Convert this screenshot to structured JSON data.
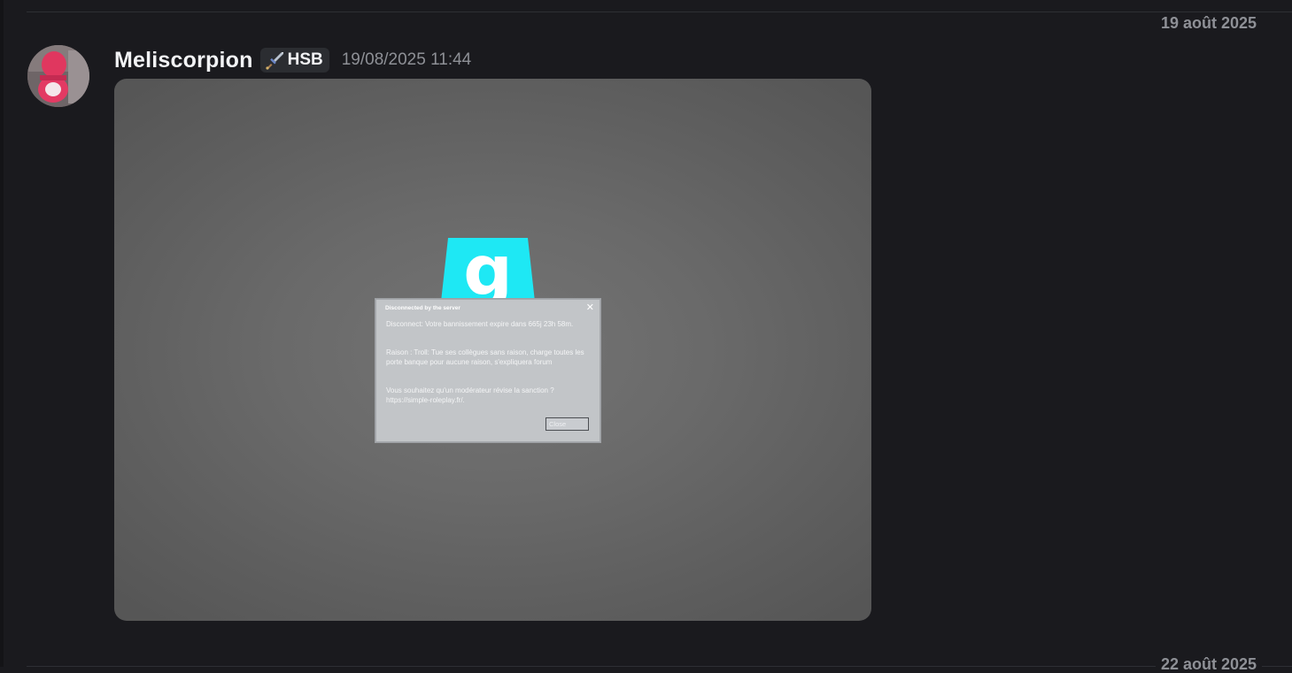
{
  "date_dividers": {
    "top": "19 août 2025",
    "bottom": "22 août 2025"
  },
  "message": {
    "username": "Meliscorpion",
    "tag": {
      "icon": "sword-icon",
      "label": "HSB"
    },
    "timestamp": "19/08/2025 11:44",
    "attachment": {
      "logo_letter": "g",
      "dialog": {
        "title": "Disconnected by the server",
        "line1": "Disconnect: Votre bannissement expire dans 665j 23h 58m.",
        "line2": "Raison : Troll: Tue ses collègues sans raison, charge toutes les porte banque pour aucune raison, s'expliquera forum",
        "line3": "Vous souhaitez qu'un modérateur révise la sanction ? https://simple-roleplay.fr/.",
        "close_label": "Close"
      }
    }
  },
  "colors": {
    "background": "#1a1a1e",
    "logo_cyan": "#1ee8f4",
    "muted_text": "#8e9096"
  }
}
